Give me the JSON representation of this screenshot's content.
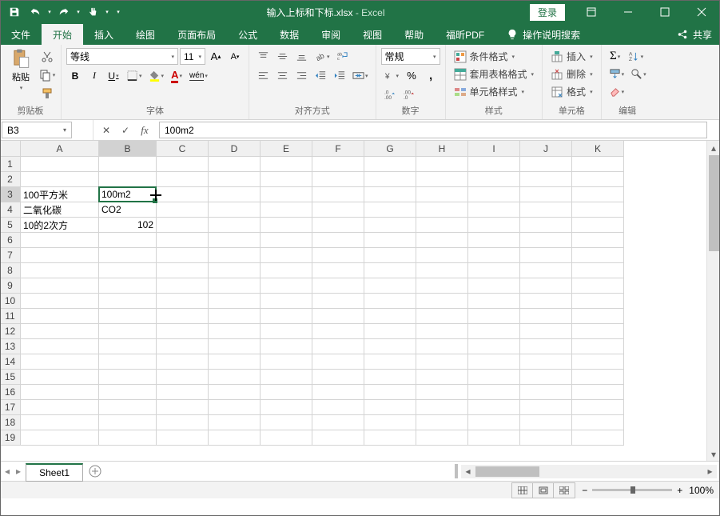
{
  "title": {
    "filename": "输入上标和下标.xlsx",
    "app": "Excel",
    "login": "登录"
  },
  "tabs": {
    "file": "文件",
    "home": "开始",
    "insert": "插入",
    "draw": "绘图",
    "layout": "页面布局",
    "formulas": "公式",
    "data": "数据",
    "review": "审阅",
    "view": "视图",
    "help": "帮助",
    "foxit": "福昕PDF",
    "tell_me": "操作说明搜索",
    "share": "共享"
  },
  "ribbon": {
    "clipboard": {
      "paste": "粘贴",
      "label": "剪贴板"
    },
    "font": {
      "name": "等线",
      "size": "11",
      "label": "字体"
    },
    "alignment": {
      "label": "对齐方式"
    },
    "number": {
      "format": "常规",
      "label": "数字"
    },
    "styles": {
      "cond": "条件格式",
      "table": "套用表格格式",
      "cell": "单元格样式",
      "label": "样式"
    },
    "cells": {
      "insert": "插入",
      "delete": "删除",
      "format": "格式",
      "label": "单元格"
    },
    "editing": {
      "label": "编辑"
    }
  },
  "formula_bar": {
    "name_box": "B3",
    "formula": "100m2"
  },
  "columns": [
    "A",
    "B",
    "C",
    "D",
    "E",
    "F",
    "G",
    "H",
    "I",
    "J",
    "K"
  ],
  "rows_count": 19,
  "active_cell": {
    "col": 1,
    "row": 2
  },
  "cells": [
    {
      "r": 2,
      "c": 0,
      "v": "100平方米"
    },
    {
      "r": 2,
      "c": 1,
      "v": "100m2"
    },
    {
      "r": 3,
      "c": 0,
      "v": "二氧化碳"
    },
    {
      "r": 3,
      "c": 1,
      "v": "CO2"
    },
    {
      "r": 4,
      "c": 0,
      "v": "10的2次方"
    },
    {
      "r": 4,
      "c": 1,
      "v": "102",
      "align": "right"
    }
  ],
  "sheet": {
    "name": "Sheet1"
  },
  "status": {
    "zoom": "100%"
  }
}
